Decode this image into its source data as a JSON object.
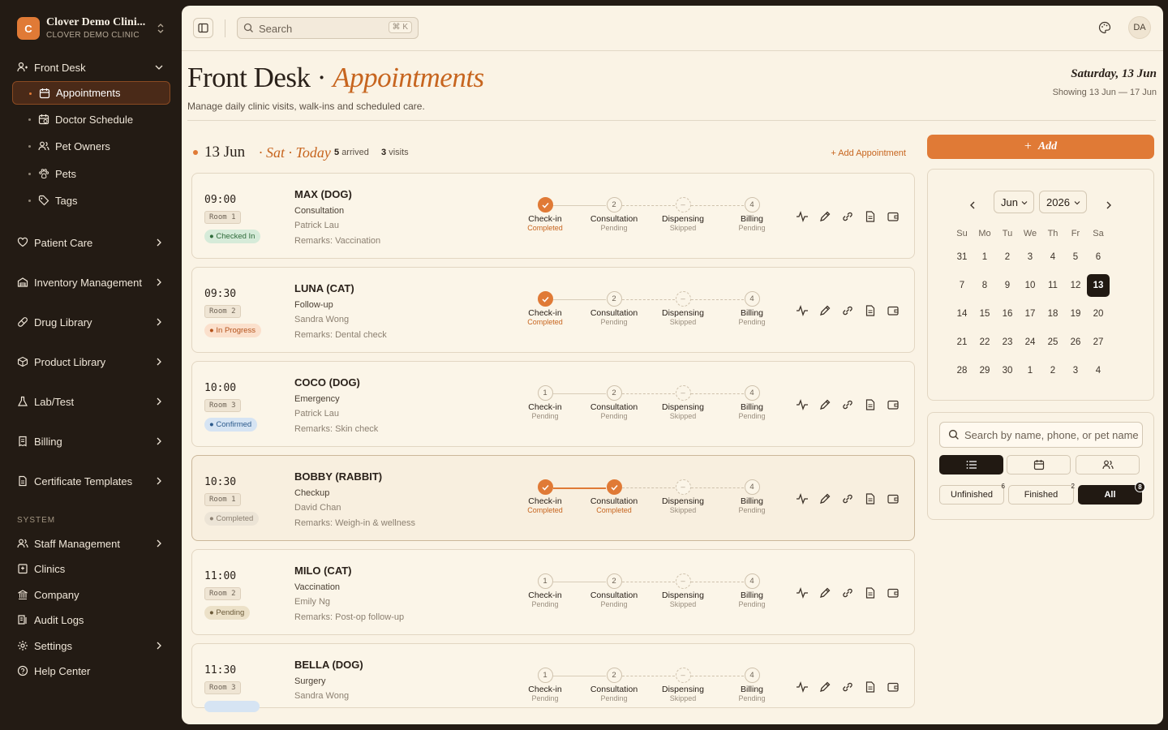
{
  "clinic": {
    "initial": "C",
    "name": "Clover Demo Clini...",
    "subtitle": "CLOVER DEMO CLINIC"
  },
  "sidebar": {
    "front_desk": "Front Desk",
    "front_desk_items": [
      "Appointments",
      "Doctor Schedule",
      "Pet Owners",
      "Pets",
      "Tags"
    ],
    "groups": [
      "Patient Care",
      "Inventory Management",
      "Drug Library",
      "Product Library",
      "Lab/Test",
      "Billing",
      "Certificate Templates"
    ],
    "system_label": "SYSTEM",
    "system_items": [
      "Staff Management",
      "Clinics",
      "Company",
      "Audit Logs",
      "Settings",
      "Help Center"
    ]
  },
  "topbar": {
    "search_placeholder": "Search",
    "shortcut": "⌘ K",
    "avatar": "DA"
  },
  "page": {
    "title_main": "Front Desk · ",
    "title_accent": "Appointments",
    "description": "Manage daily clinic visits, walk-ins and scheduled care.",
    "date": "Saturday, 13 Jun",
    "range": "Showing 13 Jun — 17 Jun"
  },
  "day": {
    "date": "13 Jun",
    "today": "· Sat · Today",
    "arrived_count": "5",
    "arrived_label": "arrived",
    "visits_count": "3",
    "visits_label": "visits",
    "add_link": "+ Add Appointment"
  },
  "step_labels": [
    "Check-in",
    "Consultation",
    "Dispensing",
    "Billing"
  ],
  "appointments": [
    {
      "time": "09:00",
      "room": "Room 1",
      "status": "Checked In",
      "pet": "MAX (DOG)",
      "type": "Consultation",
      "doctor": "Patrick Lau",
      "remarks": "Remarks: Vaccination",
      "steps": [
        "Completed",
        "Pending",
        "Skipped",
        "Pending"
      ]
    },
    {
      "time": "09:30",
      "room": "Room 2",
      "status": "In Progress",
      "pet": "LUNA (CAT)",
      "type": "Follow-up",
      "doctor": "Sandra Wong",
      "remarks": "Remarks: Dental check",
      "steps": [
        "Completed",
        "Pending",
        "Skipped",
        "Pending"
      ]
    },
    {
      "time": "10:00",
      "room": "Room 3",
      "status": "Confirmed",
      "pet": "COCO (DOG)",
      "type": "Emergency",
      "doctor": "Patrick Lau",
      "remarks": "Remarks: Skin check",
      "steps": [
        "Pending",
        "Pending",
        "Skipped",
        "Pending"
      ]
    },
    {
      "time": "10:30",
      "room": "Room 1",
      "status": "Completed",
      "pet": "BOBBY (RABBIT)",
      "type": "Checkup",
      "doctor": "David Chan",
      "remarks": "Remarks: Weigh-in & wellness",
      "steps": [
        "Completed",
        "Completed",
        "Skipped",
        "Pending"
      ]
    },
    {
      "time": "11:00",
      "room": "Room 2",
      "status": "Pending",
      "pet": "MILO (CAT)",
      "type": "Vaccination",
      "doctor": "Emily Ng",
      "remarks": "Remarks: Post-op follow-up",
      "steps": [
        "Pending",
        "Pending",
        "Skipped",
        "Pending"
      ]
    },
    {
      "time": "11:30",
      "room": "Room 3",
      "status": "",
      "pet": "BELLA (DOG)",
      "type": "Surgery",
      "doctor": "Sandra Wong",
      "remarks": "",
      "steps": [
        "Pending",
        "Pending",
        "Skipped",
        "Pending"
      ]
    }
  ],
  "status_colors": {
    "Checked In": "#d6ebd9",
    "In Progress": "#fbe0cc",
    "Confirmed": "#d6e4f3",
    "Completed": "#ece4d6",
    "Pending": "#ece1c8"
  },
  "right": {
    "add_label": "Add",
    "month": "Jun",
    "year": "2026",
    "weekdays": [
      "Su",
      "Mo",
      "Tu",
      "We",
      "Th",
      "Fr",
      "Sa"
    ],
    "weeks": [
      [
        "31",
        "1",
        "2",
        "3",
        "4",
        "5",
        "6"
      ],
      [
        "7",
        "8",
        "9",
        "10",
        "11",
        "12",
        "13"
      ],
      [
        "14",
        "15",
        "16",
        "17",
        "18",
        "19",
        "20"
      ],
      [
        "21",
        "22",
        "23",
        "24",
        "25",
        "26",
        "27"
      ],
      [
        "28",
        "29",
        "30",
        "1",
        "2",
        "3",
        "4"
      ]
    ],
    "selected_day": "13",
    "filter_placeholder": "Search by name, phone, or pet name",
    "filters": [
      {
        "label": "Unfinished",
        "count": "6"
      },
      {
        "label": "Finished",
        "count": "2"
      },
      {
        "label": "All",
        "count": "8"
      }
    ]
  },
  "accent_color": "#e07a36"
}
